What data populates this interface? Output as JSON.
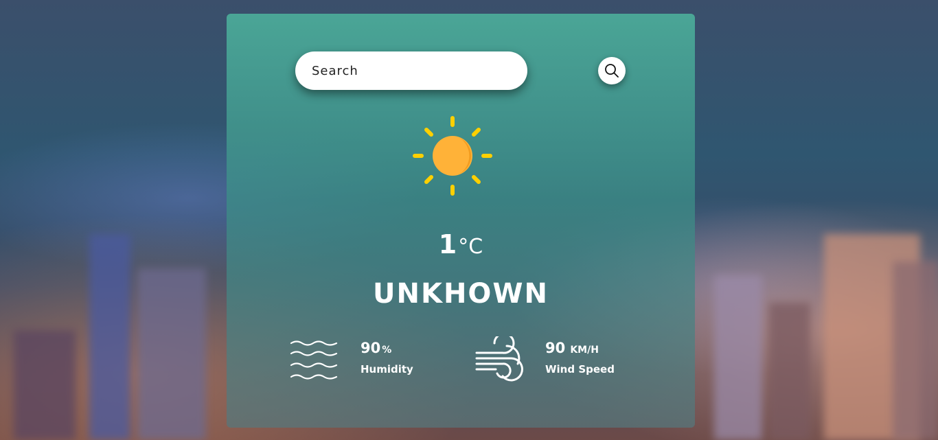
{
  "search": {
    "placeholder": "Search"
  },
  "weather": {
    "temperature": "1",
    "unit": "°C",
    "city": "UNKHOWN",
    "icon": "sun-icon"
  },
  "humidity": {
    "value": "90",
    "suffix": "%",
    "label": "Humidity",
    "icon": "humidity-icon"
  },
  "wind": {
    "value": "90",
    "suffix": "KM/H",
    "label": "Wind Speed",
    "icon": "wind-icon"
  },
  "colors": {
    "card": "#4caf9b",
    "sun": "#ffb238",
    "sun_rays": "#ffd000",
    "text": "#ffffff"
  }
}
